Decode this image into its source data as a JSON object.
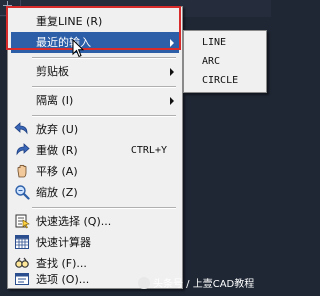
{
  "menu": {
    "items": [
      {
        "label": "重复LINE (R)"
      },
      {
        "label": "最近的输入"
      },
      {
        "label": "剪贴板"
      },
      {
        "label": "隔离 (I)"
      },
      {
        "label": "放弃 (U)"
      },
      {
        "label": "重做 (R)",
        "shortcut": "CTRL+Y"
      },
      {
        "label": "平移 (A)"
      },
      {
        "label": "缩放 (Z)"
      },
      {
        "label": "快速选择 (Q)..."
      },
      {
        "label": "快速计算器"
      },
      {
        "label": "查找 (F)..."
      },
      {
        "label": "选项 (O)..."
      }
    ]
  },
  "submenu": {
    "items": [
      "LINE",
      "ARC",
      "CIRCLE"
    ]
  },
  "watermark": {
    "text": "头条号 / 上壹CAD教程"
  },
  "colors": {
    "highlight": "#2d5fa8",
    "annotation_box": "#d72b2b",
    "menu_bg": "#f0f0f0",
    "background": "#1f2735"
  },
  "icons": [
    "undo-icon",
    "redo-icon",
    "pan-icon",
    "zoom-icon",
    "quick-select-icon",
    "calculator-icon",
    "find-icon",
    "options-icon"
  ]
}
